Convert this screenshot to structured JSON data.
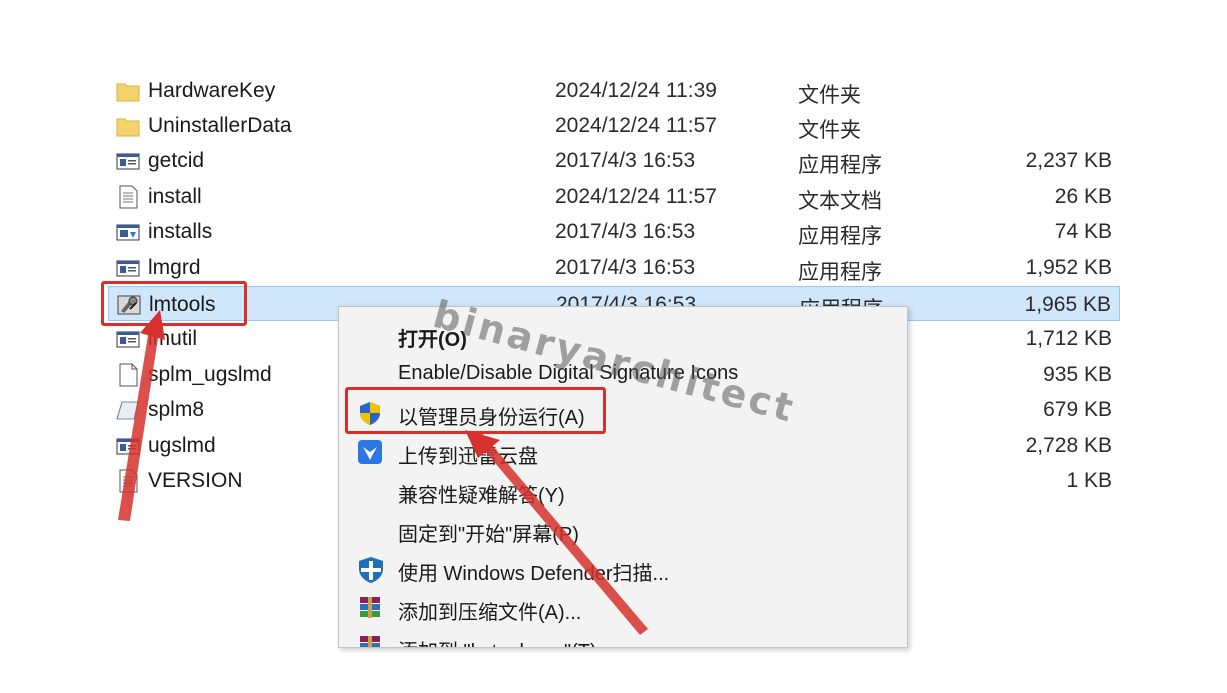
{
  "files": [
    {
      "name": "HardwareKey",
      "date": "2024/12/24 11:39",
      "type": "文件夹",
      "size": "",
      "icon": "folder-icon"
    },
    {
      "name": "UninstallerData",
      "date": "2024/12/24 11:57",
      "type": "文件夹",
      "size": "",
      "icon": "folder-icon"
    },
    {
      "name": "getcid",
      "date": "2017/4/3 16:53",
      "type": "应用程序",
      "size": "2,237 KB",
      "icon": "application-icon"
    },
    {
      "name": "install",
      "date": "2024/12/24 11:57",
      "type": "文本文档",
      "size": "26 KB",
      "icon": "text-document-icon"
    },
    {
      "name": "installs",
      "date": "2017/4/3 16:53",
      "type": "应用程序",
      "size": "74 KB",
      "icon": "installer-icon"
    },
    {
      "name": "lmgrd",
      "date": "2017/4/3 16:53",
      "type": "应用程序",
      "size": "1,952 KB",
      "icon": "application-icon"
    },
    {
      "name": "lmtools",
      "date": "2017/4/3 16:53",
      "type": "应用程序",
      "size": "1,965 KB",
      "icon": "lmtools-icon"
    },
    {
      "name": "lmutil",
      "date": "",
      "type": "",
      "size": "1,712 KB",
      "icon": "application-icon"
    },
    {
      "name": "splm_ugslmd",
      "date": "",
      "type": "",
      "size": "935 KB",
      "icon": "text-document-icon"
    },
    {
      "name": "splm8",
      "date": "",
      "type": "",
      "size": "679 KB",
      "icon": "license-file-icon"
    },
    {
      "name": "ugslmd",
      "date": "",
      "type": "",
      "size": "2,728 KB",
      "icon": "application-icon"
    },
    {
      "name": "VERSION",
      "date": "",
      "type": "",
      "size": "1 KB",
      "icon": "text-document-icon"
    }
  ],
  "context_menu": {
    "items": [
      {
        "label": "打开(O)",
        "icon": "",
        "bold": true
      },
      {
        "label": "Enable/Disable Digital Signature Icons",
        "icon": ""
      },
      {
        "label": "以管理员身份运行(A)",
        "icon": "uac-shield-icon"
      },
      {
        "label": "上传到迅雷云盘",
        "icon": "thunder-cloud-icon"
      },
      {
        "label": "兼容性疑难解答(Y)",
        "icon": ""
      },
      {
        "label": "固定到\"开始\"屏幕(P)",
        "icon": ""
      },
      {
        "label": "使用 Windows Defender扫描...",
        "icon": "defender-icon"
      },
      {
        "label": "添加到压缩文件(A)...",
        "icon": "winrar-icon"
      },
      {
        "label": "添加到 \"lmtools.rar\"(T)",
        "icon": "winrar-icon"
      }
    ]
  },
  "watermark": "binaryarchitect",
  "colors": {
    "highlight": "#d6312c",
    "selection": "#cfe6fb"
  }
}
